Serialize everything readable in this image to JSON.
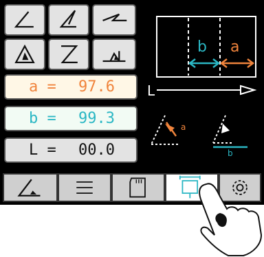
{
  "values": {
    "a": {
      "label": "a =",
      "value": "97.6",
      "color": "#f0843c",
      "bg": "#fff7e6"
    },
    "b": {
      "label": "b =",
      "value": "99.3",
      "color": "#2bb7c4",
      "bg": "#f2fbf4"
    },
    "L": {
      "label": "L =",
      "value": "00.0",
      "color": "#111111",
      "bg": "#e3e3e3"
    }
  },
  "diagram": {
    "label_a": "a",
    "label_b": "b",
    "label_L": "L",
    "small_a": "a",
    "small_b": "b"
  },
  "mode_buttons": [
    "corner-angle-icon",
    "double-angle-icon",
    "z-offset-icon",
    "filled-triangle-icon",
    "z-bend-icon",
    "flat-triangle-icon"
  ],
  "tabs": [
    {
      "name": "tab-angle",
      "icon": "angle-icon",
      "active": false
    },
    {
      "name": "tab-menu",
      "icon": "menu-icon",
      "active": false
    },
    {
      "name": "tab-memory",
      "icon": "sd-card-icon",
      "active": false
    },
    {
      "name": "tab-measure",
      "icon": "measure-icon",
      "active": true
    },
    {
      "name": "tab-settings",
      "icon": "gear-icon",
      "active": false
    }
  ],
  "colors": {
    "accent_teal": "#2bb7c4",
    "accent_orange": "#f0843c",
    "screen_bg": "#000000"
  }
}
